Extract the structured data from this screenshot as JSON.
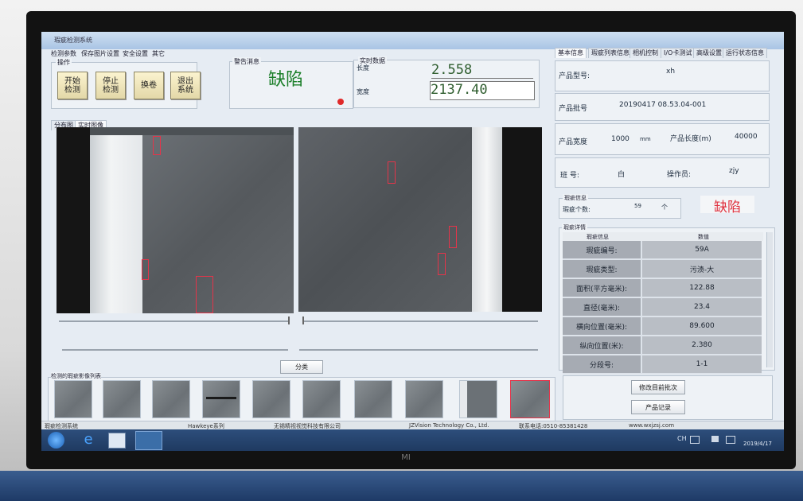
{
  "window": {
    "title": "瑕疵检测系统"
  },
  "menu": [
    "检测参数",
    "保存图片设置",
    "安全设置",
    "其它"
  ],
  "operation": {
    "label": "操作",
    "buttons": [
      {
        "line1": "开始",
        "line2": "检测"
      },
      {
        "line1": "停止",
        "line2": "检测"
      },
      {
        "line1": "换卷",
        "line2": ""
      },
      {
        "line1": "退出",
        "line2": "系统"
      }
    ]
  },
  "alarm": {
    "label": "警告消息",
    "text": "缺陷",
    "indicator_color": "#e02a2a"
  },
  "realtime": {
    "label": "实时数据",
    "length_label": "长度",
    "length_value": "2.558",
    "width_label": "宽度",
    "width_value": "2137.40"
  },
  "view_tabs": [
    "分布图",
    "实时图像"
  ],
  "classify_button": "分类",
  "thumbs_label": "检测的瑕疵影像列表",
  "right_tabs": [
    "基本信息",
    "瑕疵列表信息",
    "相机控制",
    "I/O卡测试",
    "高级设置",
    "运行状态信息"
  ],
  "product": {
    "model_label": "产品型号:",
    "model_value": "xh",
    "batch_label": "产品批号",
    "batch_value": "20190417 08.53.04-001",
    "width_label": "产品宽度",
    "width_value": "1000",
    "width_unit": "mm",
    "length_label": "产品长度(m)",
    "length_value": "40000",
    "shift_label": "班 号:",
    "shift_value": "白",
    "operator_label": "操作员:",
    "operator_value": "zjy"
  },
  "defect_info": {
    "label": "瑕疵信息",
    "count_label": "瑕疵个数:",
    "count_value": "59",
    "count_unit": "个",
    "status": "缺陷"
  },
  "defect_detail": {
    "label": "瑕疵详情",
    "col1": "瑕疵信息",
    "col2": "数值",
    "rows": [
      {
        "k": "瑕疵编号:",
        "v": "59A"
      },
      {
        "k": "瑕疵类型:",
        "v": "污渍-大"
      },
      {
        "k": "面积(平方毫米):",
        "v": "122.88"
      },
      {
        "k": "直径(毫米):",
        "v": "23.4"
      },
      {
        "k": "横向位置(毫米):",
        "v": "89.600"
      },
      {
        "k": "纵向位置(米):",
        "v": "2.380"
      },
      {
        "k": "分段号:",
        "v": "1-1"
      }
    ]
  },
  "actions": {
    "modify": "修改目前批次",
    "records": "产品记录"
  },
  "status": [
    "瑕疵检测系统",
    "Hawkeye系列",
    "无锡精视视觉科技有限公司",
    "JZVision Technology Co., Ltd.",
    "联系电话:0510-85381428",
    "www.wxjzsj.com"
  ],
  "tray": {
    "lang": "CH",
    "date": "2019/4/17"
  },
  "monitor_logo": "MI"
}
